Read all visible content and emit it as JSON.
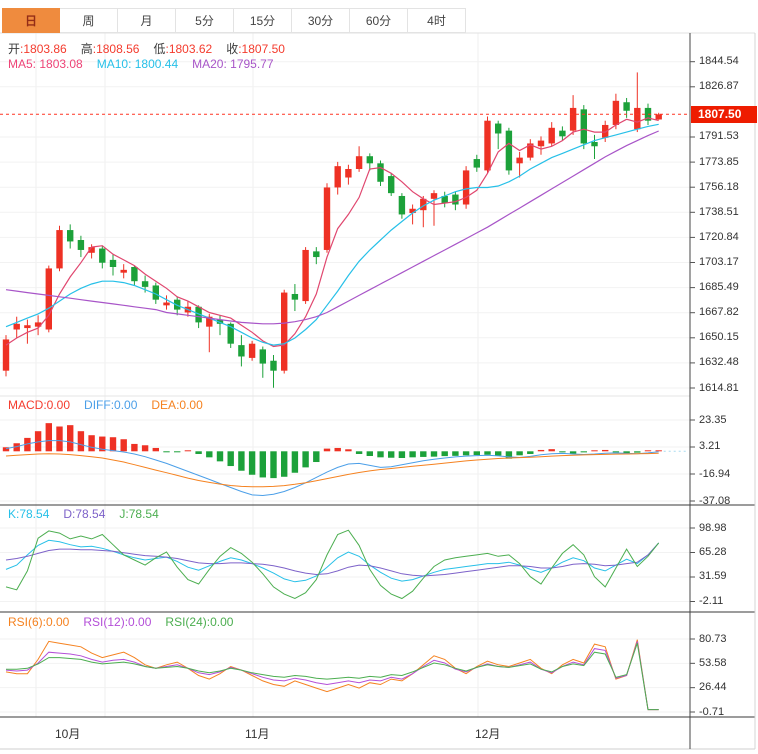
{
  "toolbar": {
    "tabs": [
      {
        "label": "日",
        "active": true
      },
      {
        "label": "周",
        "active": false
      },
      {
        "label": "月",
        "active": false
      },
      {
        "label": "5分",
        "active": false
      },
      {
        "label": "15分",
        "active": false
      },
      {
        "label": "30分",
        "active": false
      },
      {
        "label": "60分",
        "active": false
      },
      {
        "label": "4时",
        "active": false
      }
    ]
  },
  "main": {
    "ohlc_legend": [
      {
        "label": "开",
        "value": ":1803.86"
      },
      {
        "label": "高",
        "value": ":1808.56"
      },
      {
        "label": "低",
        "value": ":1803.62"
      },
      {
        "label": "收",
        "value": ":1807.50"
      }
    ],
    "ma_legend": [
      {
        "text": "MA5: 1803.08",
        "color": "#ee4477"
      },
      {
        "text": "MA10: 1800.44",
        "color": "#27c0e8"
      },
      {
        "text": "MA20: 1795.77",
        "color": "#a855c8"
      }
    ],
    "price_tag": "1807.50"
  },
  "macd_panel": {
    "legend": [
      {
        "text": "MACD:0.00",
        "color": "#f43b2d"
      },
      {
        "text": "DIFF:0.00",
        "color": "#4b9fe8"
      },
      {
        "text": "DEA:0.00",
        "color": "#f58220"
      }
    ]
  },
  "kdj_panel": {
    "legend": [
      {
        "text": "K:78.54",
        "color": "#27c0e8"
      },
      {
        "text": "D:78.54",
        "color": "#7d62c9"
      },
      {
        "text": "J:78.54",
        "color": "#4cae50"
      }
    ]
  },
  "rsi_panel": {
    "legend": [
      {
        "text": "RSI(6):0.00",
        "color": "#f58220"
      },
      {
        "text": "RSI(12):0.00",
        "color": "#b44fd8"
      },
      {
        "text": "RSI(24):0.00",
        "color": "#4cae50"
      }
    ]
  },
  "x_axis": {
    "labels": [
      "10月",
      "11月",
      "12月"
    ]
  },
  "colors": {
    "up": "#ee3124",
    "down": "#1ca13a",
    "ma5": "#e0476f",
    "ma10": "#27c0e8",
    "ma20": "#a855c8",
    "diff": "#4b9fe8",
    "dea": "#f58220",
    "k": "#27c0e8",
    "d": "#7d62c9",
    "j": "#4cae50",
    "rsi6": "#f58220",
    "rsi12": "#b44fd8",
    "rsi24": "#4cae50",
    "price_line": "#ff3322",
    "tag_bg": "#ee1c00",
    "tab_active_bg": "#ef8b3e"
  },
  "chart_data": [
    {
      "type": "candlestick",
      "title": "",
      "x_labels": [
        "10月",
        "11月",
        "12月"
      ],
      "y_ticks": [
        1844.54,
        1826.87,
        1791.53,
        1773.85,
        1756.18,
        1738.51,
        1720.84,
        1703.17,
        1685.49,
        1667.82,
        1650.15,
        1632.48,
        1614.81
      ],
      "current_price": 1807.5,
      "ohlc": [
        [
          1627,
          1652,
          1623,
          1649
        ],
        [
          1656,
          1665,
          1650,
          1660
        ],
        [
          1657,
          1663,
          1646,
          1659
        ],
        [
          1658,
          1666,
          1652,
          1661
        ],
        [
          1656,
          1701,
          1654,
          1699
        ],
        [
          1699,
          1729,
          1697,
          1726
        ],
        [
          1726,
          1730,
          1713,
          1718
        ],
        [
          1719,
          1722,
          1707,
          1712
        ],
        [
          1710,
          1716,
          1706,
          1714
        ],
        [
          1713,
          1715,
          1699,
          1703
        ],
        [
          1705,
          1709,
          1694,
          1700
        ],
        [
          1696,
          1702,
          1692,
          1698
        ],
        [
          1700,
          1701,
          1687,
          1690
        ],
        [
          1690,
          1694,
          1682,
          1686
        ],
        [
          1687,
          1689,
          1674,
          1677
        ],
        [
          1673,
          1680,
          1670,
          1675
        ],
        [
          1677,
          1679,
          1666,
          1670
        ],
        [
          1668,
          1676,
          1665,
          1672
        ],
        [
          1672,
          1673,
          1657,
          1661
        ],
        [
          1658,
          1667,
          1640,
          1665
        ],
        [
          1663,
          1666,
          1652,
          1660
        ],
        [
          1660,
          1661,
          1643,
          1646
        ],
        [
          1645,
          1652,
          1630,
          1637
        ],
        [
          1636,
          1648,
          1634,
          1646
        ],
        [
          1642,
          1644,
          1622,
          1632
        ],
        [
          1634,
          1638,
          1615,
          1627
        ],
        [
          1627,
          1684,
          1625,
          1682
        ],
        [
          1681,
          1688,
          1669,
          1677
        ],
        [
          1676,
          1714,
          1674,
          1712
        ],
        [
          1711,
          1714,
          1702,
          1707
        ],
        [
          1712,
          1759,
          1710,
          1756
        ],
        [
          1756,
          1774,
          1751,
          1771
        ],
        [
          1763,
          1772,
          1758,
          1769
        ],
        [
          1769,
          1785,
          1767,
          1778
        ],
        [
          1778,
          1780,
          1768,
          1773
        ],
        [
          1773,
          1775,
          1757,
          1760
        ],
        [
          1764,
          1766,
          1750,
          1752
        ],
        [
          1750,
          1752,
          1734,
          1737
        ],
        [
          1738,
          1744,
          1730,
          1741
        ],
        [
          1740,
          1750,
          1728,
          1748
        ],
        [
          1748,
          1754,
          1729,
          1752
        ],
        [
          1750,
          1753,
          1742,
          1745
        ],
        [
          1751,
          1753,
          1740,
          1744
        ],
        [
          1744,
          1771,
          1741,
          1768
        ],
        [
          1776,
          1779,
          1767,
          1770
        ],
        [
          1768,
          1806,
          1766,
          1803
        ],
        [
          1801,
          1803,
          1783,
          1794
        ],
        [
          1796,
          1798,
          1765,
          1768
        ],
        [
          1773,
          1781,
          1763,
          1777
        ],
        [
          1777,
          1790,
          1775,
          1787
        ],
        [
          1785,
          1792,
          1779,
          1789
        ],
        [
          1787,
          1802,
          1785,
          1798
        ],
        [
          1796,
          1799,
          1789,
          1792
        ],
        [
          1796,
          1821,
          1793,
          1812
        ],
        [
          1811,
          1814,
          1783,
          1787
        ],
        [
          1788,
          1793,
          1776,
          1785
        ],
        [
          1791,
          1803,
          1788,
          1800
        ],
        [
          1800,
          1822,
          1797,
          1817
        ],
        [
          1816,
          1819,
          1805,
          1810
        ],
        [
          1797,
          1837,
          1795,
          1812
        ],
        [
          1812,
          1815,
          1800,
          1803
        ],
        [
          1803.86,
          1808.56,
          1803.62,
          1807.5
        ]
      ],
      "ma5": [
        1645,
        1650,
        1654,
        1657,
        1666,
        1681,
        1693,
        1703,
        1714,
        1715,
        1709,
        1705,
        1701,
        1695,
        1690,
        1685,
        1679,
        1676,
        1672,
        1668,
        1666,
        1664,
        1659,
        1654,
        1648,
        1644,
        1645,
        1653,
        1665,
        1681,
        1707,
        1727,
        1737,
        1749,
        1769,
        1770,
        1766,
        1760,
        1753,
        1748,
        1744,
        1745,
        1746,
        1749,
        1754,
        1766,
        1781,
        1787,
        1782,
        1786,
        1783,
        1785,
        1789,
        1795,
        1797,
        1795,
        1795,
        1800,
        1804,
        1802,
        1805,
        1803.08
      ],
      "ma10": [
        1658,
        1661,
        1664,
        1667,
        1671,
        1676,
        1681,
        1685,
        1688,
        1690,
        1690,
        1689,
        1687,
        1684,
        1681,
        1677,
        1673,
        1670,
        1667,
        1664,
        1661,
        1658,
        1654,
        1650,
        1647,
        1645,
        1646,
        1650,
        1656,
        1663,
        1673,
        1683,
        1694,
        1704,
        1712,
        1719,
        1726,
        1732,
        1738,
        1743,
        1747,
        1750,
        1753,
        1755,
        1756,
        1756,
        1757,
        1760,
        1764,
        1769,
        1773,
        1777,
        1780,
        1783,
        1786,
        1789,
        1791,
        1793,
        1795,
        1797,
        1799,
        1800.44
      ],
      "ma20": [
        1684,
        1683,
        1682,
        1681,
        1680,
        1679,
        1678,
        1677,
        1676,
        1675,
        1674,
        1673,
        1672,
        1671,
        1670,
        1668,
        1667,
        1666,
        1665,
        1664,
        1663,
        1662,
        1661,
        1660.5,
        1660,
        1660,
        1660.5,
        1661.5,
        1663,
        1665,
        1668,
        1672,
        1676,
        1680,
        1684,
        1688,
        1692,
        1696,
        1700,
        1704,
        1708,
        1712,
        1716,
        1720,
        1724,
        1728,
        1732.5,
        1737,
        1741.5,
        1746,
        1750.5,
        1755,
        1759.5,
        1764,
        1768.5,
        1773,
        1777.5,
        1781.5,
        1785.5,
        1789,
        1792.5,
        1795.77
      ]
    },
    {
      "type": "bar",
      "name": "MACD",
      "y_ticks": [
        23.35,
        3.21,
        -16.94,
        -37.08
      ],
      "histogram": [
        3,
        6,
        10,
        15,
        21,
        18.5,
        19.5,
        15,
        12,
        11,
        10.5,
        9,
        5.5,
        4.5,
        2.5,
        -0.4,
        -0.6,
        0.5,
        -2,
        -4.5,
        -7.5,
        -11,
        -14.5,
        -17.5,
        -19.5,
        -20,
        -19,
        -16,
        -12,
        -8,
        2,
        2.5,
        1.5,
        -2,
        -3.5,
        -4.5,
        -4.8,
        -5,
        -4.5,
        -4.2,
        -4,
        -3.6,
        -3.4,
        -3,
        -2.8,
        -2.6,
        -3.2,
        -5.5,
        -3,
        -2,
        1,
        1.6,
        -0.8,
        -1.8,
        -0.8,
        0.6,
        1,
        -0.8,
        -2.2,
        -1,
        0.5,
        0.3
      ],
      "diff": [
        2,
        3.5,
        5.5,
        7,
        8,
        8,
        7,
        5,
        3,
        1.5,
        0.5,
        -0.5,
        -2,
        -4,
        -6.5,
        -9,
        -12,
        -15,
        -18,
        -21,
        -24,
        -27,
        -30,
        -32.5,
        -33,
        -32,
        -30,
        -27,
        -23.5,
        -19.5,
        -15.5,
        -12,
        -9.5,
        -9,
        -10.5,
        -12,
        -11.5,
        -10,
        -8.5,
        -7,
        -6,
        -5,
        -4.2,
        -3.6,
        -3.2,
        -3,
        -3.4,
        -4.2,
        -4.6,
        -3.8,
        -2.6,
        -1.8,
        -1.6,
        -2,
        -2.4,
        -2,
        -1.4,
        -1.2,
        -1.6,
        -1.8,
        -1.2,
        -0.4
      ],
      "dea": [
        -3.5,
        -3,
        -2.5,
        -2,
        -1.8,
        -2,
        -2.5,
        -3.2,
        -4,
        -5,
        -6.5,
        -8,
        -10,
        -12,
        -14,
        -16,
        -18,
        -20,
        -21.8,
        -23.2,
        -24.5,
        -25.5,
        -26.2,
        -26.5,
        -26.5,
        -26.2,
        -25.6,
        -24.6,
        -23.4,
        -22,
        -20.4,
        -18.8,
        -17.2,
        -15.8,
        -14.6,
        -13.6,
        -12.8,
        -12,
        -11.2,
        -10.4,
        -9.6,
        -8.8,
        -8,
        -7.2,
        -6.5,
        -5.9,
        -5.4,
        -5,
        -4.7,
        -4.4,
        -4,
        -3.6,
        -3.2,
        -2.9,
        -2.7,
        -2.5,
        -2.3,
        -2.1,
        -2,
        -1.9,
        -1.7,
        -1.4
      ]
    },
    {
      "type": "line",
      "name": "KDJ",
      "y_ticks": [
        98.98,
        65.28,
        31.59,
        -2.11
      ],
      "k": [
        42,
        48,
        62,
        75,
        82,
        80,
        76,
        73,
        74,
        71,
        67,
        62,
        58,
        55,
        57,
        59,
        53,
        45,
        41,
        47,
        53,
        58,
        55,
        50,
        44,
        37,
        29,
        25,
        27,
        33,
        45,
        58,
        66,
        60,
        48,
        38,
        30,
        26,
        28,
        33,
        38,
        42,
        44,
        46,
        48,
        50,
        50,
        52,
        48,
        42,
        38,
        44,
        52,
        58,
        54,
        44,
        40,
        48,
        56,
        50,
        62,
        78.54
      ],
      "d": [
        55,
        57,
        60,
        64,
        68,
        70,
        70,
        69,
        69,
        68,
        67,
        65,
        63,
        61,
        60,
        59,
        57,
        54,
        51,
        50,
        50,
        51,
        51,
        50,
        49,
        47,
        44,
        40,
        37,
        35,
        36,
        40,
        45,
        48,
        47,
        44,
        40,
        36,
        34,
        33,
        34,
        35,
        37,
        39,
        41,
        43,
        45,
        47,
        47,
        46,
        44,
        44,
        46,
        49,
        50,
        49,
        47,
        48,
        50,
        52,
        62,
        78.54
      ],
      "j": [
        18,
        14,
        40,
        85,
        95,
        92,
        84,
        88,
        84,
        90,
        76,
        62,
        55,
        48,
        58,
        66,
        45,
        28,
        22,
        42,
        60,
        72,
        64,
        52,
        36,
        18,
        8,
        2,
        10,
        28,
        62,
        90,
        96,
        75,
        42,
        20,
        8,
        2,
        12,
        30,
        46,
        55,
        58,
        60,
        62,
        64,
        60,
        62,
        50,
        32,
        22,
        44,
        64,
        76,
        62,
        32,
        18,
        44,
        70,
        46,
        60,
        78.54
      ]
    },
    {
      "type": "line",
      "name": "RSI",
      "y_ticks": [
        80.73,
        53.58,
        26.44,
        -0.71
      ],
      "rsi6": [
        44,
        42,
        42,
        58,
        78,
        76,
        74,
        72,
        65,
        60,
        63,
        66,
        60,
        52,
        48,
        52,
        55,
        48,
        40,
        36,
        42,
        50,
        46,
        40,
        34,
        30,
        28,
        34,
        30,
        26,
        22,
        26,
        30,
        26,
        32,
        30,
        36,
        34,
        42,
        52,
        62,
        58,
        48,
        42,
        50,
        56,
        52,
        50,
        54,
        58,
        48,
        42,
        52,
        58,
        54,
        75,
        72,
        36,
        40,
        80,
        2,
        2
      ],
      "rsi12": [
        46,
        45,
        46,
        54,
        66,
        65,
        64,
        62,
        58,
        55,
        57,
        58,
        55,
        50,
        48,
        50,
        52,
        48,
        43,
        41,
        44,
        49,
        46,
        42,
        38,
        35,
        34,
        37,
        35,
        32,
        30,
        32,
        34,
        32,
        35,
        34,
        38,
        36,
        42,
        50,
        57,
        54,
        47,
        44,
        49,
        53,
        50,
        49,
        52,
        55,
        47,
        43,
        50,
        55,
        52,
        70,
        68,
        37,
        40,
        78,
        2,
        2
      ],
      "rsi24": [
        47,
        47,
        48,
        53,
        60,
        60,
        59,
        58,
        55,
        53,
        54,
        55,
        53,
        50,
        48,
        49,
        50,
        48,
        45,
        43,
        45,
        48,
        46,
        43,
        41,
        39,
        38,
        40,
        39,
        37,
        36,
        37,
        38,
        37,
        39,
        38,
        41,
        40,
        44,
        49,
        54,
        52,
        48,
        45,
        49,
        52,
        50,
        49,
        51,
        53,
        47,
        44,
        50,
        53,
        51,
        66,
        64,
        38,
        41,
        76,
        2,
        2
      ]
    }
  ]
}
